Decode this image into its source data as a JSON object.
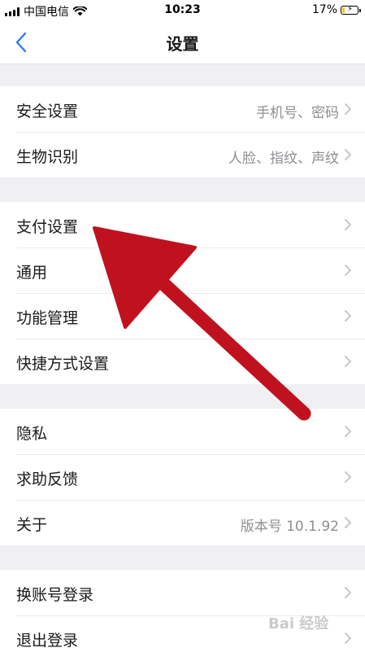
{
  "status_bar": {
    "carrier": "中国电信",
    "time": "10:23",
    "battery": "17%",
    "battery_level": 0.17
  },
  "nav": {
    "title": "设置",
    "back_icon": "chevron-left-icon"
  },
  "groups": [
    {
      "items": [
        {
          "label": "安全设置",
          "value": "手机号、密码"
        },
        {
          "label": "生物识别",
          "value": "人脸、指纹、声纹"
        }
      ]
    },
    {
      "items": [
        {
          "label": "支付设置",
          "value": ""
        },
        {
          "label": "通用",
          "value": ""
        },
        {
          "label": "功能管理",
          "value": ""
        },
        {
          "label": "快捷方式设置",
          "value": ""
        }
      ]
    },
    {
      "items": [
        {
          "label": "隐私",
          "value": ""
        },
        {
          "label": "求助反馈",
          "value": ""
        },
        {
          "label": "关于",
          "value": "版本号 10.1.92"
        }
      ]
    },
    {
      "items": [
        {
          "label": "换账号登录",
          "value": ""
        },
        {
          "label": "退出登录",
          "value": ""
        }
      ]
    }
  ],
  "annotation": {
    "color": "#c0121e"
  },
  "watermark": "Bai 经验",
  "colors": {
    "accent": "#2f7cf6",
    "background": "#efeff4",
    "chevron": "#c7c7cc"
  }
}
